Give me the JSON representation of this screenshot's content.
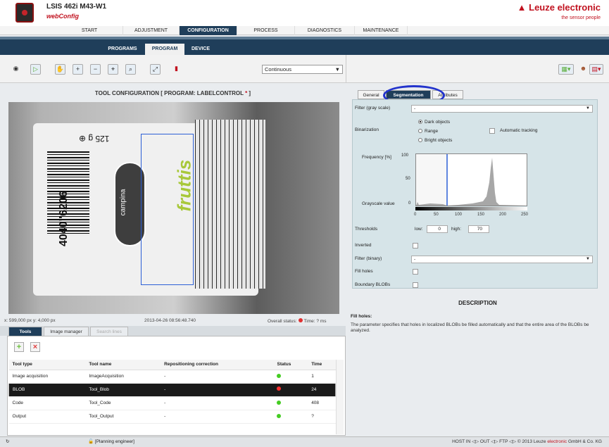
{
  "header": {
    "product": "LSIS 462i M43-W1",
    "webconfig": "webConfig",
    "brand": "Leuze electronic",
    "tagline": "the sensor people",
    "brand_color": "#c1121f"
  },
  "nav": {
    "tabs": [
      "START",
      "ADJUSTMENT",
      "CONFIGURATION",
      "PROCESS",
      "DIAGNOSTICS",
      "MAINTENANCE"
    ],
    "active": "CONFIGURATION"
  },
  "subnav": {
    "tabs": [
      "PROGRAMS",
      "PROGRAM",
      "DEVICE"
    ],
    "active": "PROGRAM"
  },
  "toolbar": {
    "mode_value": "Continuous",
    "icons": [
      "camera-icon",
      "play-icon",
      "hand-icon",
      "zoom-in-icon",
      "zoom-out-icon",
      "zoom-fit-icon",
      "zoom-reset-icon",
      "arrows-icon",
      "save-config-icon"
    ],
    "right_icons": [
      "export-icon",
      "users-icon",
      "window-layout-icon"
    ]
  },
  "tool_config": {
    "title": "TOOL CONFIGURATION   [ PROGRAM: LABELCONTROL",
    "star": " *",
    "close": " ]"
  },
  "image": {
    "barcode_number": "4040\"6206",
    "weight_text": "125 g ⊕",
    "campina": "campina",
    "fruttis": "fruttis",
    "coords": "x: 599,000 px y: 4,000 px",
    "timestamp": "2013-04-26 08:56:48.740",
    "overall_status": "Overall status:",
    "time": "Time: ? ms"
  },
  "bottom_tabs": [
    "Tools",
    "Image manager",
    "Search lines"
  ],
  "tools_table": {
    "columns": [
      "Tool type",
      "Tool name",
      "Repositioning correction",
      "Status",
      "Time"
    ],
    "rows": [
      {
        "type": "Image acquisition",
        "name": "ImageAcquisition",
        "repos": "-",
        "status": "#44cc22",
        "time": "1"
      },
      {
        "type": "BLOB",
        "name": "Tool_Blob",
        "repos": "-",
        "status": "#ff3030",
        "time": "24"
      },
      {
        "type": "Code",
        "name": "Tool_Code",
        "repos": "-",
        "status": "#44cc22",
        "time": "408"
      },
      {
        "type": "Output",
        "name": "Tool_Output",
        "repos": "-",
        "status": "#44cc22",
        "time": "?"
      }
    ]
  },
  "right_tabs": [
    "General",
    "Segmentation",
    "Attributes"
  ],
  "segmentation": {
    "filter_gray_label": "Filter (gray scale)",
    "filter_gray_value": "-",
    "binarization_label": "Binarization",
    "options": [
      "Dark objects",
      "Range",
      "Bright objects"
    ],
    "selected_option": "Dark objects",
    "auto_tracking": "Automatic tracking",
    "frequency_label": "Frequency [%]",
    "grayscale_label": "Grayscale value",
    "y_ticks": [
      "100",
      "50",
      "0"
    ],
    "x_ticks": [
      "0",
      "50",
      "100",
      "150",
      "200",
      "250"
    ],
    "thresholds_label": "Thresholds",
    "low_label": "low:",
    "low_value": "0",
    "high_label": "high:",
    "high_value": "70",
    "inverted_label": "Inverted",
    "filter_binary_label": "Filter (binary)",
    "filter_binary_value": "-",
    "fill_holes_label": "Fill holes",
    "boundary_label": "Boundary BLOBs"
  },
  "description": {
    "title": "DESCRIPTION",
    "heading": "Fill holes:",
    "body": "The parameter specifies that holes in localized BLOBs be filled automatically and that the entire area of the BLOBs be analyzed."
  },
  "statusbar": {
    "user": "[Planning engineer]",
    "host_in": "HOST IN",
    "out": "OUT",
    "ftp": "FTP",
    "copyright_pre": "© 2013 Leuze ",
    "copyright_brand": "electronic",
    "copyright_post": " GmbH & Co. KG"
  }
}
